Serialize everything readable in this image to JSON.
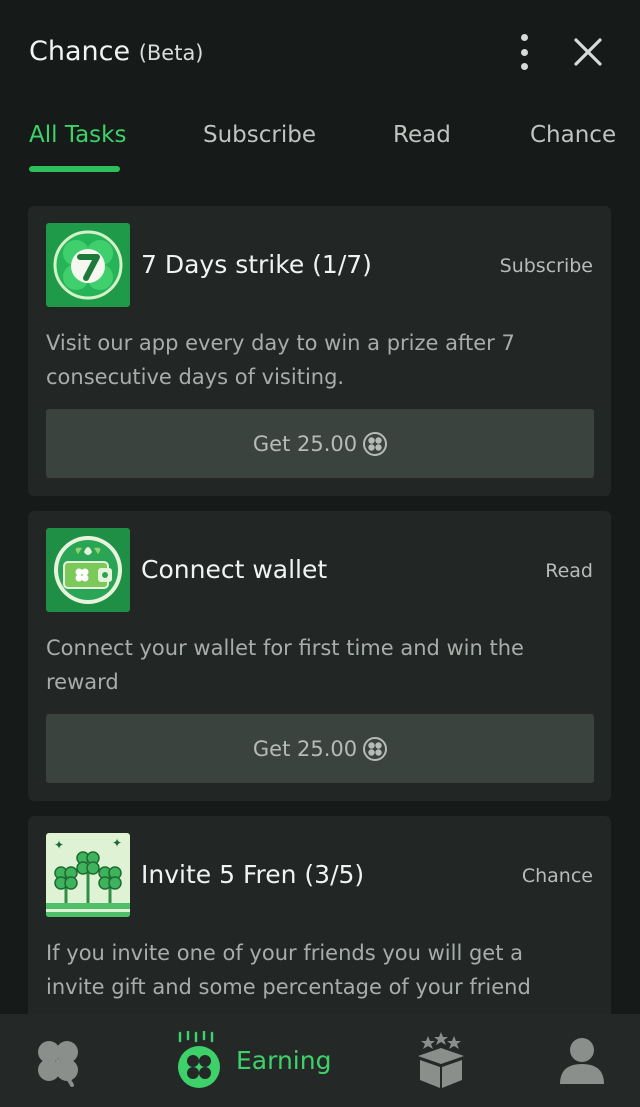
{
  "header": {
    "title": "Chance",
    "subtitle": "(Beta)"
  },
  "tabs": [
    {
      "label": "All Tasks",
      "active": true
    },
    {
      "label": "Subscribe",
      "active": false
    },
    {
      "label": "Read",
      "active": false
    },
    {
      "label": "Chance",
      "active": false
    }
  ],
  "tasks": [
    {
      "title": "7 Days strike (1/7)",
      "category": "Subscribe",
      "description": "Visit our app every day to win a prize after 7 consecutive days of visiting.",
      "button_label": "Get 25.00",
      "icon": "lucky-seven-clover-icon"
    },
    {
      "title": "Connect wallet",
      "category": "Read",
      "description": "Connect your wallet for first time and win the reward",
      "button_label": "Get 25.00",
      "icon": "wallet-clover-icon"
    },
    {
      "title": "Invite 5 Fren (3/5)",
      "category": "Chance",
      "description": "If you invite one of your friends you will get a invite gift and some percentage of your friend",
      "icon": "clover-plants-icon"
    }
  ],
  "bottom_nav": {
    "items": [
      {
        "icon": "clover-icon",
        "label": ""
      },
      {
        "icon": "earning-clover-icon",
        "label": "Earning",
        "active": true
      },
      {
        "icon": "gift-box-icon",
        "label": ""
      },
      {
        "icon": "user-icon",
        "label": ""
      }
    ]
  },
  "colors": {
    "background": "#161a18",
    "card": "#222725",
    "accent": "#3ed16a",
    "button": "#3b433e"
  }
}
